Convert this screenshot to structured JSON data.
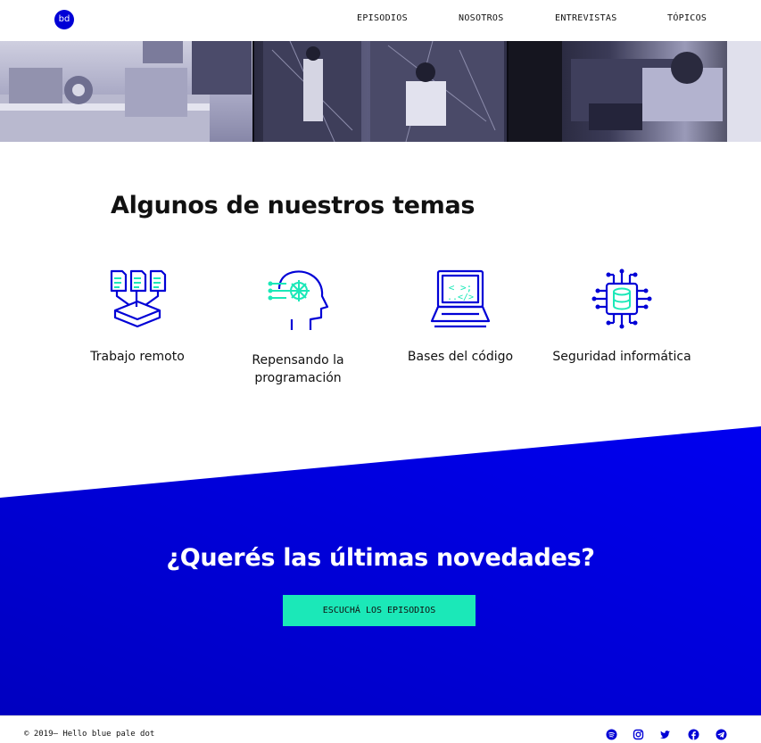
{
  "nav": {
    "logo": "bd",
    "links": [
      "EPISODIOS",
      "NOSOTROS",
      "ENTREVISTAS",
      "TÓPICOS"
    ]
  },
  "topics": {
    "title": "Algunos de nuestros temas",
    "items": [
      {
        "label": "Trabajo remoto",
        "icon": "remote-work-icon"
      },
      {
        "label": "Repensando la programación",
        "icon": "ai-head-icon"
      },
      {
        "label": "Bases del código",
        "icon": "laptop-code-icon"
      },
      {
        "label": "Seguridad informática",
        "icon": "database-circuit-icon"
      }
    ]
  },
  "cta": {
    "title": "¿Querés las últimas novedades?",
    "button": "ESCUCHÁ LOS EPISODIOS"
  },
  "footer": {
    "copyright": "© 2019— Hello blue pale dot",
    "social": [
      "spotify-icon",
      "instagram-icon",
      "twitter-icon",
      "facebook-icon",
      "telegram-icon"
    ]
  },
  "colors": {
    "brand_blue": "#0000d6",
    "accent_teal": "#1be8b8"
  }
}
